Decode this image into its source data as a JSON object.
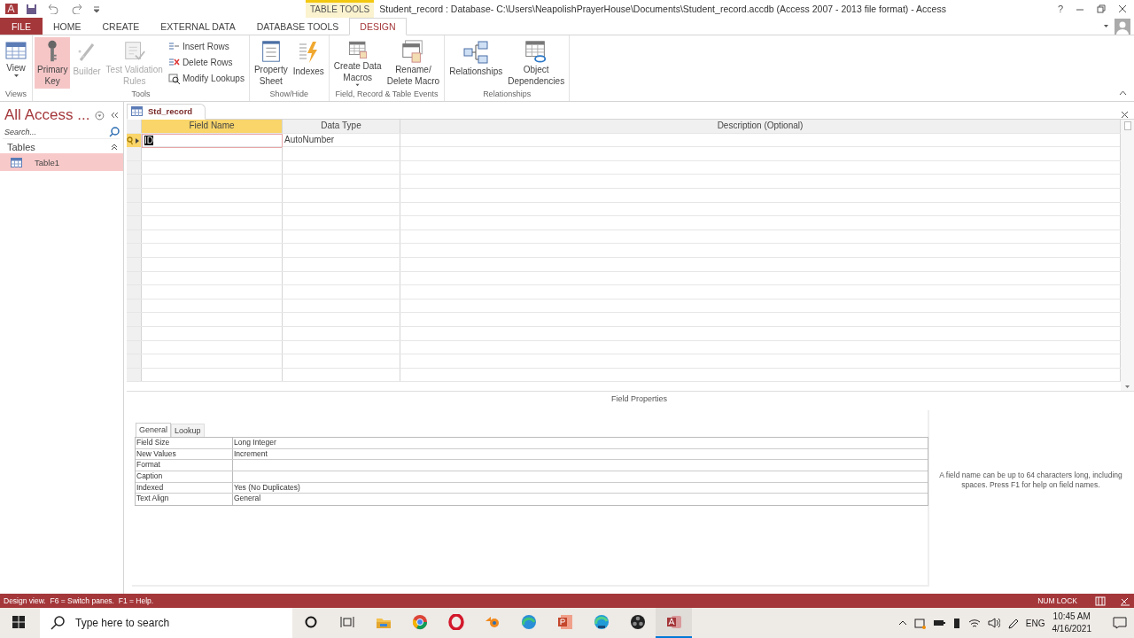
{
  "title_bar": {
    "contextual_tab": "TABLE TOOLS",
    "title": "Student_record : Database- C:\\Users\\NeapolishPrayerHouse\\Documents\\Student_record.accdb (Access 2007 - 2013 file format) - Access",
    "help": "?"
  },
  "ribbon_tabs": [
    {
      "label": "FILE",
      "kind": "file",
      "selected": false
    },
    {
      "label": "HOME",
      "kind": "tab",
      "selected": false
    },
    {
      "label": "CREATE",
      "kind": "tab",
      "selected": false
    },
    {
      "label": "EXTERNAL DATA",
      "kind": "tab",
      "selected": false
    },
    {
      "label": "DATABASE TOOLS",
      "kind": "tab",
      "selected": false
    },
    {
      "label": "DESIGN",
      "kind": "tab",
      "selected": true
    }
  ],
  "ribbon_groups": [
    {
      "label": "Views",
      "commands": [
        {
          "kind": "large",
          "lines": [
            "View"
          ],
          "dropdown": true,
          "selected": false,
          "disabled": false
        }
      ]
    },
    {
      "label": "Tools",
      "commands": [
        {
          "kind": "large",
          "lines": [
            "Primary",
            "Key"
          ],
          "selected": true,
          "disabled": false
        },
        {
          "kind": "large",
          "lines": [
            "Builder"
          ],
          "selected": false,
          "disabled": true
        },
        {
          "kind": "large",
          "lines": [
            "Test Validation",
            "Rules"
          ],
          "selected": false,
          "disabled": true
        },
        {
          "kind": "small",
          "lines": [
            "Insert Rows"
          ],
          "selected": false,
          "disabled": false
        },
        {
          "kind": "small",
          "lines": [
            "Delete Rows"
          ],
          "selected": false,
          "disabled": false
        },
        {
          "kind": "small",
          "lines": [
            "Modify Lookups"
          ],
          "selected": false,
          "disabled": false
        }
      ]
    },
    {
      "label": "Show/Hide",
      "commands": [
        {
          "kind": "large",
          "lines": [
            "Property",
            "Sheet"
          ],
          "selected": false,
          "disabled": false
        },
        {
          "kind": "large",
          "lines": [
            "Indexes"
          ],
          "selected": false,
          "disabled": false
        }
      ]
    },
    {
      "label": "Field, Record & Table Events",
      "commands": [
        {
          "kind": "large",
          "lines": [
            "Create Data",
            "Macros"
          ],
          "dropdown": true,
          "selected": false,
          "disabled": false
        },
        {
          "kind": "large",
          "lines": [
            "Rename/",
            "Delete Macro"
          ],
          "selected": false,
          "disabled": false
        }
      ]
    },
    {
      "label": "Relationships",
      "commands": [
        {
          "kind": "large",
          "lines": [
            "Relationships"
          ],
          "selected": false,
          "disabled": false
        },
        {
          "kind": "large",
          "lines": [
            "Object",
            "Dependencies"
          ],
          "selected": false,
          "disabled": false
        }
      ]
    }
  ],
  "navigation_pane": {
    "title": "All Access ...",
    "search_placeholder": "Search...",
    "groups": [
      {
        "label": "Tables",
        "expanded": true,
        "items": [
          {
            "label": "Table1",
            "selected": true
          }
        ]
      }
    ]
  },
  "document_tab": "Std_record",
  "design_grid": {
    "columns": [
      {
        "label": "Field Name",
        "selected": true
      },
      {
        "label": "Data Type",
        "selected": false
      },
      {
        "label": "Description (Optional)",
        "selected": false
      }
    ],
    "rows": [
      {
        "field_name": "ID",
        "data_type": "AutoNumber",
        "primary_key": true,
        "selected": true
      }
    ]
  },
  "field_properties": {
    "title": "Field Properties",
    "tabs": [
      {
        "label": "General",
        "selected": true
      },
      {
        "label": "Lookup",
        "selected": false
      }
    ],
    "rows": [
      {
        "label": "Field Size",
        "value": "Long Integer"
      },
      {
        "label": "New Values",
        "value": "Increment"
      },
      {
        "label": "Format"
      },
      {
        "label": "Caption"
      },
      {
        "label": "Indexed",
        "value": "Yes (No Duplicates)"
      },
      {
        "label": "Text Align",
        "value": "General"
      }
    ],
    "help": "A field name can be up to 64 characters long, including spaces. Press F1 for help on field names."
  },
  "status_bar": {
    "text": "Design view.  F6 = Switch panes.  F1 = Help.",
    "indicator": "NUM LOCK"
  },
  "taskbar": {
    "search_placeholder": "Type here to search",
    "language": "ENG",
    "time": "10:45 AM",
    "date": "4/16/2021"
  }
}
